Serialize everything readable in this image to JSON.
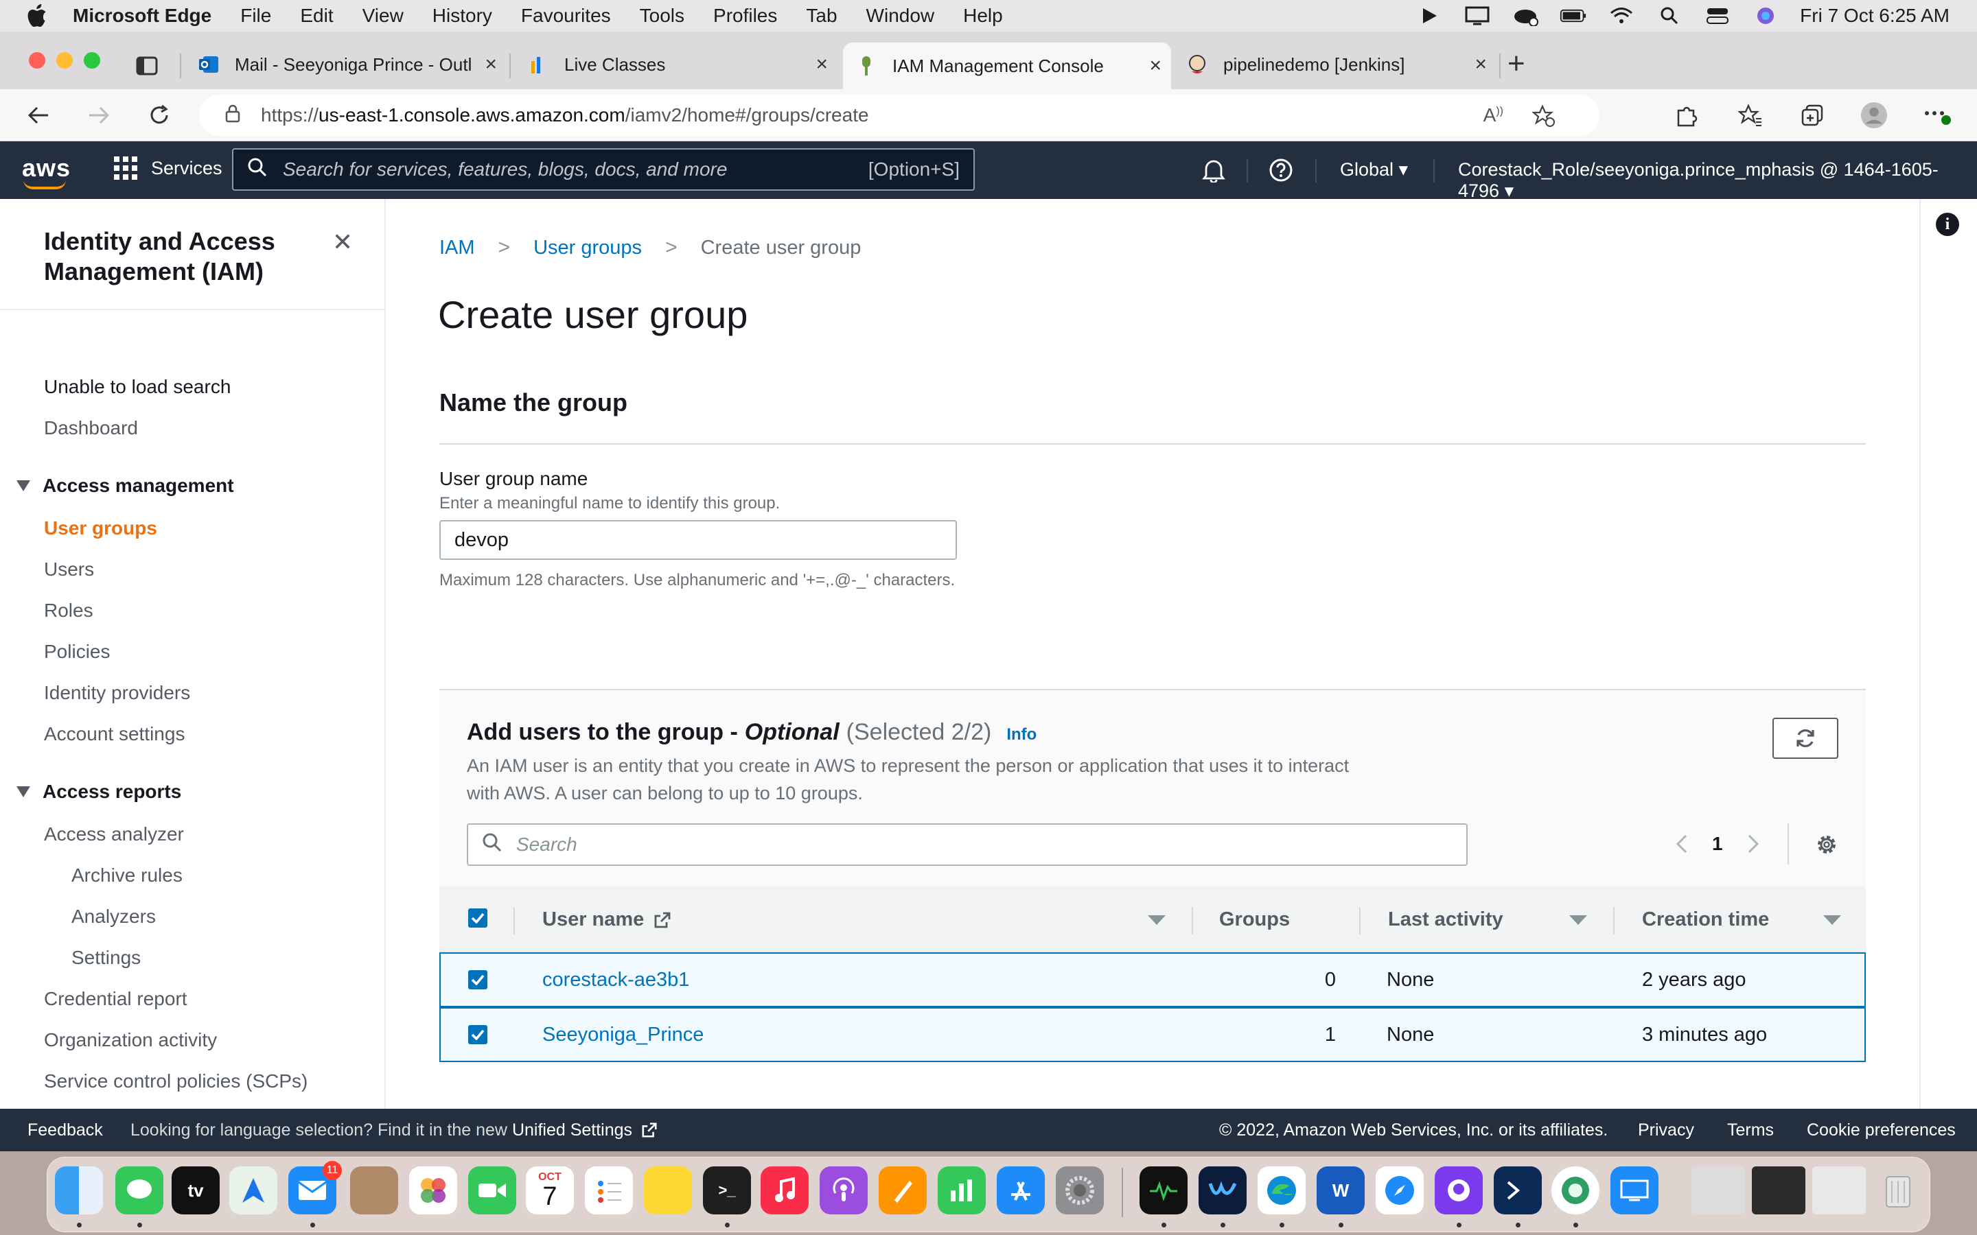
{
  "menubar": {
    "app_name": "Microsoft Edge",
    "items": [
      "File",
      "Edit",
      "View",
      "History",
      "Favourites",
      "Tools",
      "Profiles",
      "Tab",
      "Window",
      "Help"
    ],
    "clock": "Fri 7 Oct  6:25 AM"
  },
  "tabs": [
    {
      "title": "Mail - Seeyoniga Prince - Outl",
      "icon": "outlook-icon"
    },
    {
      "title": "Live Classes",
      "icon": "chart-icon"
    },
    {
      "title": "IAM Management Console",
      "icon": "aws-icon",
      "active": true
    },
    {
      "title": "pipelinedemo [Jenkins]",
      "icon": "jenkins-icon"
    }
  ],
  "address": {
    "scheme": "https://",
    "host": "us-east-1.console.aws.amazon.com",
    "path": "/iamv2/home#/groups/create"
  },
  "awsnav": {
    "logo": "aws",
    "services": "Services",
    "search_placeholder": "Search for services, features, blogs, docs, and more",
    "search_shortcut": "[Option+S]",
    "region": "Global",
    "account": "Corestack_Role/seeyoniga.prince_mphasis @ 1464-1605-4796"
  },
  "sidebar": {
    "title": "Identity and Access Management (IAM)",
    "items_top": [
      "Unable to load search",
      "Dashboard"
    ],
    "access_management": {
      "label": "Access management",
      "items": [
        "User groups",
        "Users",
        "Roles",
        "Policies",
        "Identity providers",
        "Account settings"
      ]
    },
    "access_reports": {
      "label": "Access reports",
      "items": [
        "Access analyzer"
      ],
      "sub_items": [
        "Archive rules",
        "Analyzers",
        "Settings"
      ],
      "items_after": [
        "Credential report",
        "Organization activity",
        "Service control policies (SCPs)"
      ]
    }
  },
  "breadcrumb": {
    "root": "IAM",
    "parent": "User groups",
    "current": "Create user group"
  },
  "page": {
    "title": "Create user group",
    "section": "Name the group",
    "field_label": "User group name",
    "field_desc": "Enter a meaningful name to identify this group.",
    "field_value": "devop",
    "constraint": "Maximum 128 characters. Use alphanumeric and '+=,.@-_' characters."
  },
  "users_panel": {
    "heading": "Add users to the group -",
    "optional": "Optional",
    "selected": "(Selected 2/2)",
    "info": "Info",
    "desc": "An IAM user is an entity that you create in AWS to represent the person or application that uses it to interact with AWS. A user can belong to up to 10 groups.",
    "search_placeholder": "Search",
    "page": "1",
    "columns": [
      "User name",
      "Groups",
      "Last activity",
      "Creation time"
    ],
    "rows": [
      {
        "name": "corestack-ae3b1",
        "groups": "0",
        "last_activity": "None",
        "created": "2 years ago",
        "checked": true
      },
      {
        "name": "Seeyoniga_Prince",
        "groups": "1",
        "last_activity": "None",
        "created": "3 minutes ago",
        "checked": true
      }
    ]
  },
  "footer": {
    "feedback": "Feedback",
    "lang_text": "Looking for language selection? Find it in the new",
    "lang_link": "Unified Settings",
    "copyright": "© 2022, Amazon Web Services, Inc. or its affiliates.",
    "privacy": "Privacy",
    "terms": "Terms",
    "cookies": "Cookie preferences"
  },
  "dock": {
    "calendar_month": "OCT",
    "calendar_day": "7",
    "mail_badge": "11",
    "word_letter": "W",
    "tv_label": "tv"
  },
  "colors": {
    "aws_nav": "#232f3e",
    "aws_orange": "#ec7211",
    "link_blue": "#0073bb",
    "selected_row": "#f1faff"
  }
}
